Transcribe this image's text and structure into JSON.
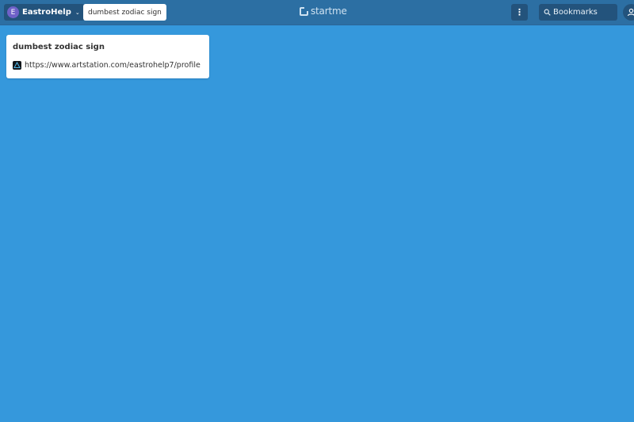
{
  "header": {
    "account": {
      "avatar_letter": "E",
      "name": "EastroHelp",
      "chevron": "⌄"
    },
    "page_tab": "dumbest zodiac sign",
    "logo_text": "startme",
    "menu_icon": "⋮",
    "search": {
      "placeholder": "Bookmarks"
    }
  },
  "widgets": [
    {
      "title": "dumbest zodiac sign",
      "bookmarks": [
        {
          "text": "https://www.artstation.com/eastrohelp7/profile",
          "icon": "artstation-icon"
        }
      ]
    }
  ],
  "colors": {
    "background": "#3598dc",
    "topbar": "#2c6fa3",
    "button": "#23537c",
    "avatar": "#6f61c8"
  }
}
